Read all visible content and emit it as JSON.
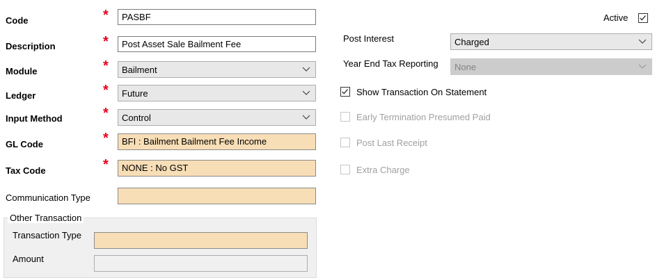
{
  "form": {
    "code": {
      "label": "Code",
      "value": "PASBF"
    },
    "description": {
      "label": "Description",
      "value": "Post Asset Sale Bailment Fee"
    },
    "module": {
      "label": "Module",
      "value": "Bailment"
    },
    "ledger": {
      "label": "Ledger",
      "value": "Future"
    },
    "input_method": {
      "label": "Input Method",
      "value": "Control"
    },
    "gl_code": {
      "label": "GL Code",
      "value": "BFI : Bailment Bailment Fee Income"
    },
    "tax_code": {
      "label": "Tax Code",
      "value": "NONE : No GST"
    },
    "communication_type": {
      "label": "Communication Type",
      "value": ""
    },
    "required_marker": "*"
  },
  "other_transaction": {
    "title": "Other Transaction",
    "transaction_type": {
      "label": "Transaction Type",
      "value": ""
    },
    "amount": {
      "label": "Amount",
      "value": ""
    }
  },
  "right": {
    "active": {
      "label": "Active",
      "checked": true
    },
    "post_interest": {
      "label": "Post Interest",
      "value": "Charged"
    },
    "year_end_tax": {
      "label": "Year End Tax Reporting",
      "value": "None"
    },
    "show_on_statement": {
      "label": "Show Transaction On Statement",
      "checked": true
    },
    "early_termination": {
      "label": "Early Termination Presumed Paid",
      "checked": false
    },
    "post_last_receipt": {
      "label": "Post Last Receipt",
      "checked": false
    },
    "extra_charge": {
      "label": "Extra Charge",
      "checked": false
    }
  },
  "colors": {
    "required": "#e8001c",
    "lookup_field": "#f8deb6",
    "combo_bg": "#e8e8e8",
    "disabled_text": "#a0a0a0"
  }
}
